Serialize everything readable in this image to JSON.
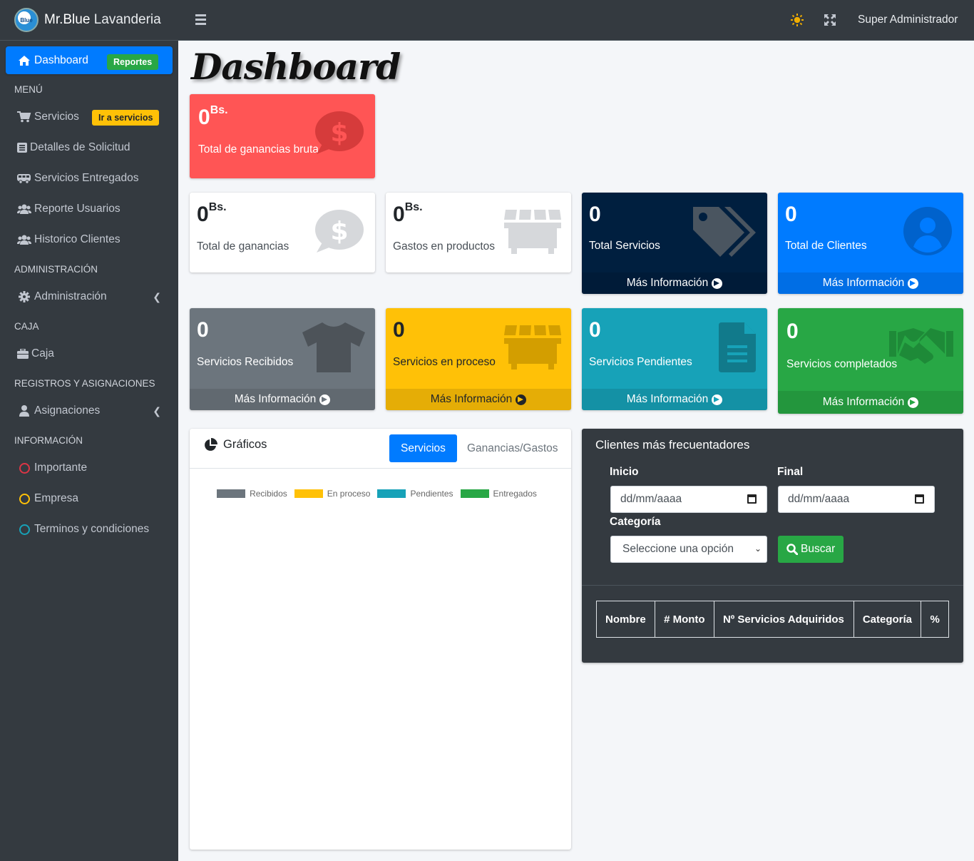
{
  "brand": {
    "name_bold": "Mr.Blue",
    "name_light": "Lavanderia",
    "logo_text": "Blue"
  },
  "sidebar": {
    "dashboard": {
      "label": "Dashboard",
      "badge": "Reportes"
    },
    "header_menu": "MENÚ",
    "servicios": {
      "label": "Servicios",
      "badge": "Ir a servicios"
    },
    "detalles": "Detalles de Solicitud",
    "entregados": "Servicios Entregados",
    "reporte_usuarios": "Reporte Usuarios",
    "historico": "Historico Clientes",
    "header_admin": "ADMINISTRACIÓN",
    "administracion": "Administración",
    "header_caja": "CAJA",
    "caja": "Caja",
    "header_registros": "REGISTROS Y ASIGNACIONES",
    "asignaciones": "Asignaciones",
    "header_info": "INFORMACIÓN",
    "importante": "Importante",
    "empresa": "Empresa",
    "terminos": "Terminos y condiciones"
  },
  "topbar": {
    "user": "Super Administrador"
  },
  "page_title": "Dashboard",
  "boxes": {
    "ganancias_bruta": {
      "value": "0",
      "unit": "Bs.",
      "label": "Total de ganancias bruta"
    },
    "ganancias": {
      "value": "0",
      "unit": "Bs.",
      "label": "Total de ganancias"
    },
    "gastos": {
      "value": "0",
      "unit": "Bs.",
      "label": "Gastos en productos"
    },
    "total_servicios": {
      "value": "0",
      "label": "Total Servicios",
      "footer": "Más Información"
    },
    "total_clientes": {
      "value": "0",
      "label": "Total de Clientes",
      "footer": "Más Información"
    },
    "recibidos": {
      "value": "0",
      "label": "Servicios Recibidos",
      "footer": "Más Información"
    },
    "proceso": {
      "value": "0",
      "label": "Servicios en proceso",
      "footer": "Más Información"
    },
    "pendientes": {
      "value": "0",
      "label": "Servicios Pendientes",
      "footer": "Más Información"
    },
    "completados": {
      "value": "0",
      "label": "Servicios completados",
      "footer": "Más Información"
    }
  },
  "chart_card": {
    "title": "Gráficos",
    "tabs": [
      "Servicios",
      "Ganancias/Gastos"
    ]
  },
  "chart_data": {
    "type": "bar",
    "categories": [],
    "series": [
      {
        "name": "Recibidos",
        "color": "#6c757d",
        "values": []
      },
      {
        "name": "En proceso",
        "color": "#ffc107",
        "values": []
      },
      {
        "name": "Pendientes",
        "color": "#17a2b8",
        "values": []
      },
      {
        "name": "Entregados",
        "color": "#28a745",
        "values": []
      }
    ],
    "legend": "top"
  },
  "clientes_card": {
    "title": "Clientes más frecuentadores",
    "inicio_label": "Inicio",
    "final_label": "Final",
    "date_placeholder": "dd/mm/aaaa",
    "categoria_label": "Categoría",
    "select_value": "Seleccione una opción",
    "buscar": "Buscar",
    "columns": [
      "Nombre",
      "# Monto",
      "Nº Servicios Adquiridos",
      "Categoría",
      "%"
    ]
  },
  "colors": {
    "primary": "#007bff",
    "success": "#28a745",
    "warning": "#ffc107",
    "info": "#17a2b8",
    "danger": "#ff5555",
    "secondary": "#6c757d",
    "dark": "#343a40",
    "navy": "#001f3f"
  }
}
